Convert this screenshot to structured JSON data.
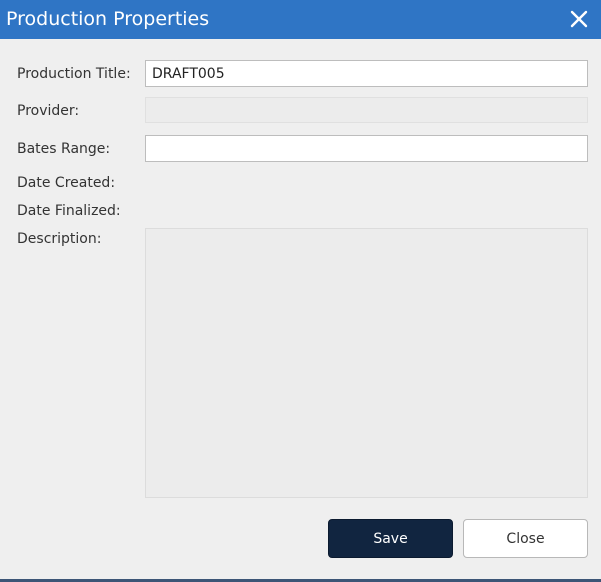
{
  "dialog": {
    "title": "Production Properties",
    "close_icon": "close-icon"
  },
  "fields": {
    "production_title": {
      "label": "Production Title:",
      "value": "DRAFT005"
    },
    "provider": {
      "label": "Provider:",
      "value": ""
    },
    "bates_range": {
      "label": "Bates Range:",
      "value": ""
    },
    "date_created": {
      "label": "Date Created:",
      "value": ""
    },
    "date_finalized": {
      "label": "Date Finalized:",
      "value": ""
    },
    "description": {
      "label": "Description:",
      "value": ""
    }
  },
  "buttons": {
    "save": "Save",
    "close": "Close"
  },
  "colors": {
    "titlebar": "#2f75c5",
    "save_button": "#112540",
    "background": "#efefef"
  }
}
